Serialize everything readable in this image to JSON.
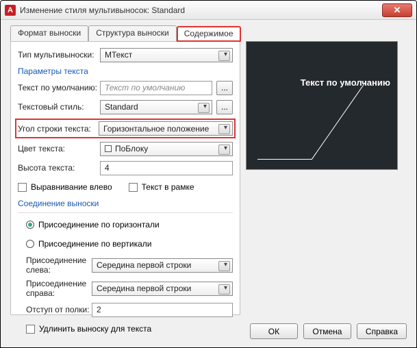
{
  "window": {
    "app_letter": "A",
    "title": "Изменение стиля мультивыносок: Standard",
    "close": "✕"
  },
  "tabs": {
    "t1": "Формат выноски",
    "t2": "Структура выноски",
    "t3": "Содержимое"
  },
  "form": {
    "mtype_label": "Тип мультивыноски:",
    "mtype_value": "МТекст",
    "group_text": "Параметры текста",
    "default_text_label": "Текст по умолчанию:",
    "default_text_placeholder": "Текст по умолчанию",
    "ellipsis": "...",
    "style_label": "Текстовый стиль:",
    "style_value": "Standard",
    "angle_label": "Угол строки текста:",
    "angle_value": "Горизонтальное положение",
    "color_label": "Цвет текста:",
    "color_value": "ПоБлоку",
    "height_label": "Высота текста:",
    "height_value": "4",
    "align_left": "Выравнивание влево",
    "frame": "Текст в рамке",
    "group_conn": "Соединение выноски",
    "conn_h": "Присоединение по горизонтали",
    "conn_v": "Присоединение по вертикали",
    "left_label": "Присоединение слева:",
    "left_value": "Середина первой строки",
    "right_label": "Присоединение справа:",
    "right_value": "Середина первой строки",
    "gap_label": "Отступ от полки:",
    "gap_value": "2",
    "extend": "Удлинить выноску для текста"
  },
  "preview": {
    "text": "Текст по умолчанию"
  },
  "footer": {
    "ok": "ОК",
    "cancel": "Отмена",
    "help": "Справка"
  }
}
